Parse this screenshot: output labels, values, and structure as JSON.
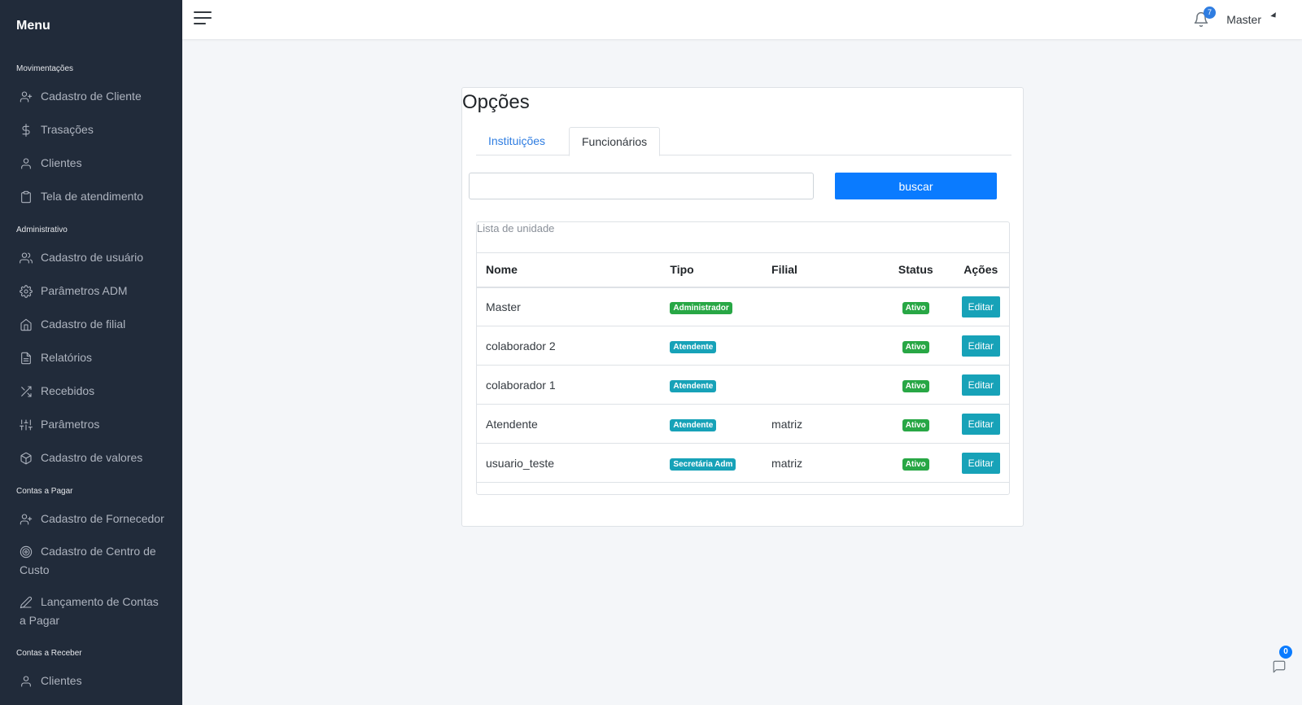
{
  "sidebar": {
    "brand": "Menu",
    "sections": [
      {
        "title": "Movimentações",
        "items": [
          {
            "label": "Cadastro de Cliente",
            "icon": "user-plus-icon"
          },
          {
            "label": "Trasações",
            "icon": "dollar-icon"
          },
          {
            "label": "Clientes",
            "icon": "user-icon"
          },
          {
            "label": "Tela de atendimento",
            "icon": "clipboard-icon"
          }
        ]
      },
      {
        "title": "Administrativo",
        "items": [
          {
            "label": "Cadastro de usuário",
            "icon": "users-icon"
          },
          {
            "label": "Parâmetros ADM",
            "icon": "gear-icon"
          },
          {
            "label": "Cadastro de filial",
            "icon": "home-icon"
          },
          {
            "label": "Relatórios",
            "icon": "file-text-icon"
          },
          {
            "label": "Recebidos",
            "icon": "shuffle-icon"
          },
          {
            "label": "Parâmetros",
            "icon": "sliders-icon"
          },
          {
            "label": "Cadastro de valores",
            "icon": "box-icon"
          }
        ]
      },
      {
        "title": "Contas a Pagar",
        "items": [
          {
            "label": "Cadastro de Fornecedor",
            "icon": "user-plus-icon"
          },
          {
            "label": "Cadastro de Centro de Custo",
            "icon": "target-icon"
          },
          {
            "label": "Lançamento de Contas a Pagar",
            "icon": "pen-icon"
          }
        ]
      },
      {
        "title": "Contas a Receber",
        "items": [
          {
            "label": "Clientes",
            "icon": "user-icon"
          }
        ]
      }
    ]
  },
  "topbar": {
    "notification_count": "7",
    "user_name": "Master"
  },
  "card": {
    "title": "Opções",
    "tabs": [
      {
        "label": "Instituições",
        "active": false
      },
      {
        "label": "Funcionários",
        "active": true
      }
    ],
    "search_value": "",
    "search_button": "buscar",
    "list_title": "Lista de unidade",
    "columns": [
      "Nome",
      "Tipo",
      "Filial",
      "Status",
      "Ações"
    ],
    "rows": [
      {
        "nome": "Master",
        "tipo": "Administrador",
        "tipo_color": "#28a745",
        "filial": "",
        "status": "Ativo",
        "action": "Editar"
      },
      {
        "nome": "colaborador 2",
        "tipo": "Atendente",
        "tipo_color": "#17a2b8",
        "filial": "",
        "status": "Ativo",
        "action": "Editar"
      },
      {
        "nome": "colaborador 1",
        "tipo": "Atendente",
        "tipo_color": "#17a2b8",
        "filial": "",
        "status": "Ativo",
        "action": "Editar"
      },
      {
        "nome": "Atendente",
        "tipo": "Atendente",
        "tipo_color": "#17a2b8",
        "filial": "matriz",
        "status": "Ativo",
        "action": "Editar"
      },
      {
        "nome": "usuario_teste",
        "tipo": "Secretária Adm",
        "tipo_color": "#17a2b8",
        "filial": "matriz",
        "status": "Ativo",
        "action": "Editar"
      }
    ]
  },
  "chat": {
    "count": "0"
  },
  "colors": {
    "sidebar_bg": "#212b3a",
    "primary": "#0a7bff",
    "info": "#17a2b8",
    "success": "#28a745"
  }
}
